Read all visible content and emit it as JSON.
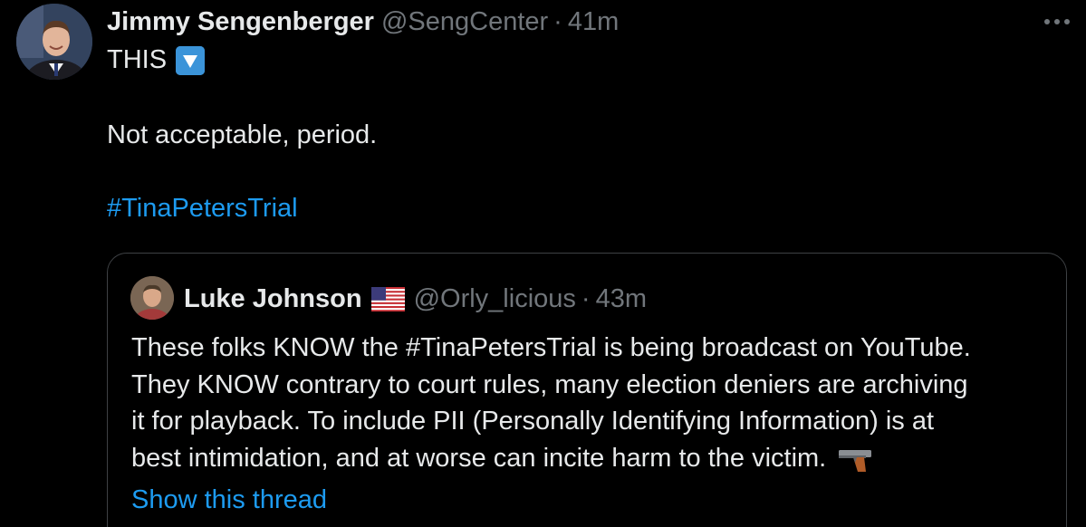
{
  "tweet": {
    "display_name": "Jimmy Sengenberger",
    "handle": "@SengCenter",
    "separator": "·",
    "time": "41m",
    "text_line1": "THIS",
    "text_line2": "Not acceptable, period.",
    "hashtag": "#TinaPetersTrial"
  },
  "quoted_tweet": {
    "display_name": "Luke Johnson",
    "handle": "@Orly_licious",
    "separator": "·",
    "time": "43m",
    "lines": [
      "These folks KNOW the #TinaPetersTrial is being broadcast on YouTube.",
      "They KNOW contrary to court rules, many election deniers are archiving",
      "it for playback. To include PII (Personally Identifying Information) is at",
      "best intimidation, and at worse can incite harm to the victim."
    ],
    "show_thread": "Show this thread"
  },
  "colors": {
    "background": "#000000",
    "text_primary": "#e7e9ea",
    "text_secondary": "#71767b",
    "link": "#1d9bf0",
    "border": "#3e4144"
  },
  "icons": [
    "avatar",
    "down-arrow-emoji",
    "more-icon",
    "us-flag-emoji",
    "pistol-emoji"
  ]
}
